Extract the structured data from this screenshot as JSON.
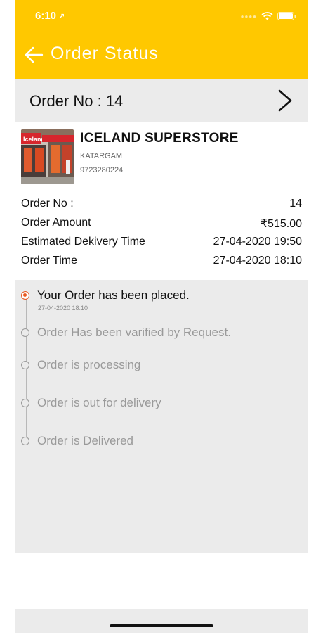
{
  "status_bar": {
    "time": "6:10",
    "arrow": "↗"
  },
  "header": {
    "title": "Order Status"
  },
  "order_bar": {
    "label": "Order No : 14"
  },
  "store": {
    "name": "ICELAND SUPERSTORE",
    "area": "KATARGAM",
    "phone": "9723280224",
    "image_sign": "Iceland"
  },
  "details": [
    {
      "label": "Order No :",
      "value": "14"
    },
    {
      "label": "Order Amount",
      "value": "₹515.00"
    },
    {
      "label": "Estimated Dekivery Time",
      "value": "27-04-2020 19:50"
    },
    {
      "label": "Order Time",
      "value": "27-04-2020 18:10"
    }
  ],
  "steps": [
    {
      "label": "Your Order has been placed.",
      "time": "27-04-2020 18:10",
      "active": true
    },
    {
      "label": "Order Has been varified by Request.",
      "active": false
    },
    {
      "label": "Order is processing",
      "active": false
    },
    {
      "label": "Order is out for delivery",
      "active": false
    },
    {
      "label": "Order is Delivered",
      "active": false
    }
  ],
  "colors": {
    "accent": "#FFC800",
    "active_step": "#E8581F",
    "panel": "#EBEBEB"
  }
}
